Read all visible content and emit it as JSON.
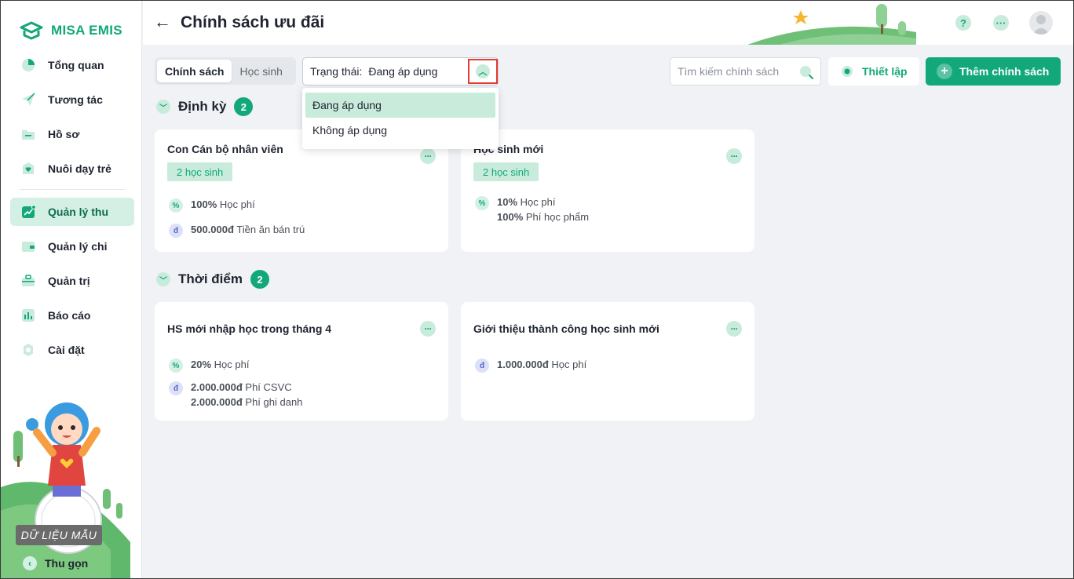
{
  "app": {
    "brand": "MISA EMIS"
  },
  "sidebar": {
    "items": [
      {
        "label": "Tổng quan",
        "icon": "pie-chart-icon"
      },
      {
        "label": "Tương tác",
        "icon": "paper-plane-icon"
      },
      {
        "label": "Hồ sơ",
        "icon": "folder-icon"
      },
      {
        "label": "Nuôi dạy trẻ",
        "icon": "heart-icon"
      },
      {
        "label": "Quản lý thu",
        "icon": "trend-icon",
        "active": true
      },
      {
        "label": "Quản lý chi",
        "icon": "wallet-icon"
      },
      {
        "label": "Quản trị",
        "icon": "briefcase-icon"
      },
      {
        "label": "Báo cáo",
        "icon": "bar-chart-icon"
      },
      {
        "label": "Cài đặt",
        "icon": "gear-icon"
      }
    ],
    "sample_badge": "DỮ LIỆU MẪU",
    "collapse_label": "Thu gọn"
  },
  "header": {
    "title": "Chính sách ưu đãi",
    "help": "?",
    "more": "···"
  },
  "toolbar": {
    "tabs": [
      {
        "label": "Chính sách",
        "active": true
      },
      {
        "label": "Học sinh",
        "active": false
      }
    ],
    "status_label": "Trạng thái:",
    "status_value": "Đang áp dụng",
    "status_options": [
      "Đang áp dụng",
      "Không áp dụng"
    ],
    "search_placeholder": "Tìm kiếm chính sách",
    "setup_label": "Thiết lập",
    "add_label": "Thêm chính sách"
  },
  "groups": [
    {
      "title": "Định kỳ",
      "count": "2",
      "cards": [
        {
          "title": "Con Cán bộ nhân viên",
          "tag": "2 học sinh",
          "rows": [
            {
              "type": "pct",
              "items": [
                {
                  "amount": "100%",
                  "label": "Học phí"
                }
              ]
            },
            {
              "type": "vnd",
              "items": [
                {
                  "amount": "500.000đ",
                  "label": "Tiền ăn bán trú"
                }
              ]
            }
          ]
        },
        {
          "title": "Học sinh mới",
          "tag": "2 học sinh",
          "rows": [
            {
              "type": "pct",
              "items": [
                {
                  "amount": "10%",
                  "label": "Học phí"
                },
                {
                  "amount": "100%",
                  "label": "Phí học phẩm"
                }
              ]
            }
          ]
        }
      ]
    },
    {
      "title": "Thời điểm",
      "count": "2",
      "cards": [
        {
          "title": "HS mới nhập học trong tháng 4",
          "rows": [
            {
              "type": "pct",
              "items": [
                {
                  "amount": "20%",
                  "label": "Học phí"
                }
              ]
            },
            {
              "type": "vnd",
              "items": [
                {
                  "amount": "2.000.000đ",
                  "label": "Phí CSVC"
                },
                {
                  "amount": "2.000.000đ",
                  "label": "Phí ghi danh"
                }
              ]
            }
          ]
        },
        {
          "title": "Giới thiệu thành công học sinh mới",
          "rows": [
            {
              "type": "vnd",
              "items": [
                {
                  "amount": "1.000.000đ",
                  "label": "Học phí"
                }
              ]
            }
          ]
        }
      ]
    }
  ],
  "colors": {
    "accent": "#12a87a",
    "accent_light": "#c8ebdc",
    "highlight_border": "#e53935"
  }
}
